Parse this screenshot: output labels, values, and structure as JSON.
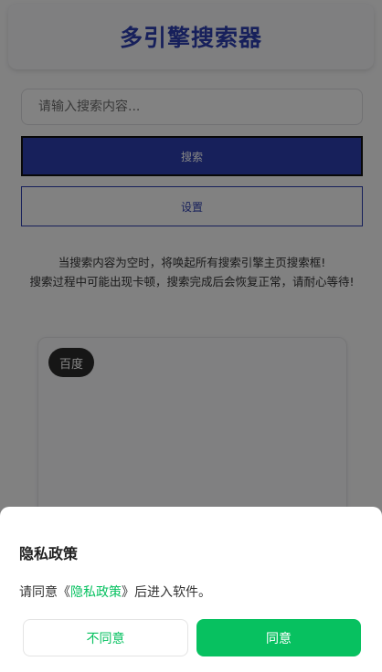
{
  "app": {
    "title": "多引擎搜索器"
  },
  "search": {
    "placeholder": "请输入搜索内容...",
    "value": ""
  },
  "buttons": {
    "search_label": "搜索",
    "settings_label": "设置"
  },
  "notice": {
    "line1": "当搜索内容为空时，将唤起所有搜索引擎主页搜索框!",
    "line2": "搜索过程中可能出现卡顿，搜索完成后会恢复正常，请耐心等待!"
  },
  "engines": [
    {
      "label": "百度"
    }
  ],
  "privacy_sheet": {
    "title": "隐私政策",
    "message_prefix": "请同意《",
    "link_text": "隐私政策",
    "message_suffix": "》后进入软件。",
    "disagree_label": "不同意",
    "agree_label": "同意"
  },
  "colors": {
    "brand": "#2d3fae",
    "accent_green": "#07c160"
  }
}
